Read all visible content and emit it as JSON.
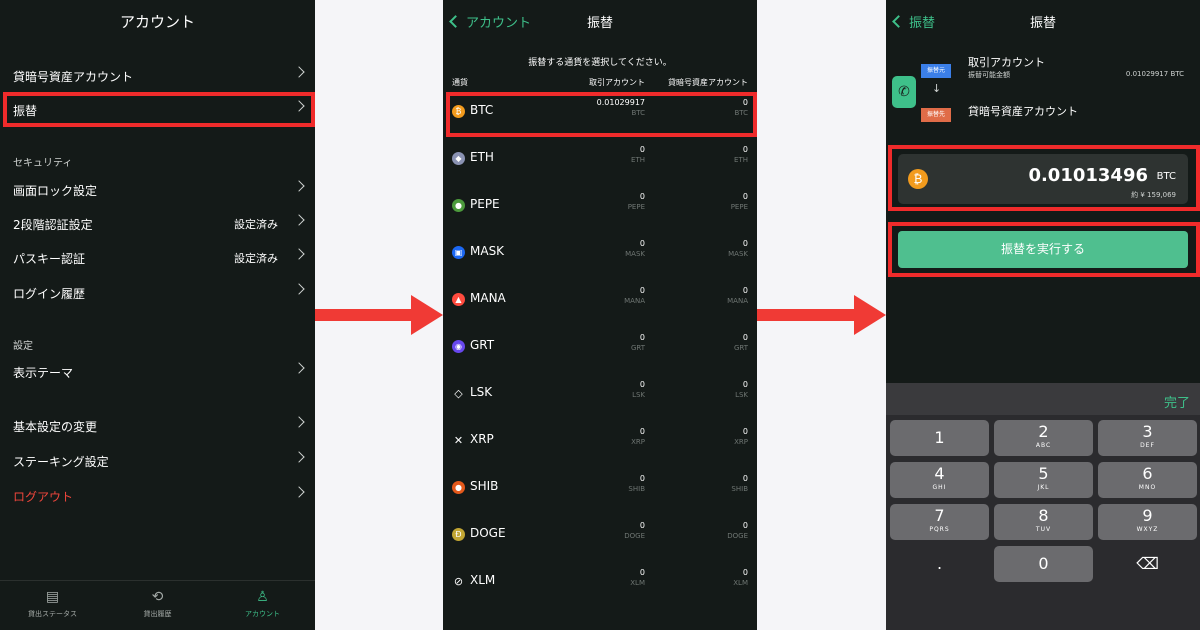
{
  "panel1": {
    "title": "アカウント",
    "items": {
      "crypto_account": "貸暗号資産アカウント",
      "transfer": "振替",
      "screen_lock": "画面ロック設定",
      "two_factor": "2段階認証設定",
      "two_factor_value": "設定済み",
      "passkey": "パスキー認証",
      "passkey_value": "設定済み",
      "login_history": "ログイン履歴",
      "theme": "表示テーマ",
      "basic_settings": "基本設定の変更",
      "staking": "ステーキング設定",
      "logout": "ログアウト"
    },
    "sections": {
      "security": "セキュリティ",
      "settings": "設定"
    },
    "tabs": [
      {
        "label": "貸出ステータス",
        "icon": "lending-status-icon"
      },
      {
        "label": "貸出履歴",
        "icon": "history-icon"
      },
      {
        "label": "アカウント",
        "icon": "account-icon"
      }
    ]
  },
  "panel2": {
    "back_label": "アカウント",
    "title": "振替",
    "instruction": "振替する通貨を選択してください。",
    "columns": {
      "currency": "通貨",
      "trading": "取引アカウント",
      "lending": "貸暗号資産アカウント"
    },
    "coins": [
      {
        "symbol": "BTC",
        "trading": "0.01029917",
        "lending": "0",
        "color": "#f29b1d",
        "glyph": "₿"
      },
      {
        "symbol": "ETH",
        "trading": "0",
        "lending": "0",
        "color": "#8a92b2",
        "glyph": "◆"
      },
      {
        "symbol": "PEPE",
        "trading": "0",
        "lending": "0",
        "color": "#4c9a3c",
        "glyph": "●"
      },
      {
        "symbol": "MASK",
        "trading": "0",
        "lending": "0",
        "color": "#1c68f3",
        "glyph": "▣"
      },
      {
        "symbol": "MANA",
        "trading": "0",
        "lending": "0",
        "color": "#ff4b3e",
        "glyph": "▲"
      },
      {
        "symbol": "GRT",
        "trading": "0",
        "lending": "0",
        "color": "#6747ed",
        "glyph": "◉"
      },
      {
        "symbol": "LSK",
        "trading": "0",
        "lending": "0",
        "color": "#141a18",
        "glyph": "◇"
      },
      {
        "symbol": "XRP",
        "trading": "0",
        "lending": "0",
        "color": "#141a18",
        "glyph": "✕"
      },
      {
        "symbol": "SHIB",
        "trading": "0",
        "lending": "0",
        "color": "#e4591b",
        "glyph": "●"
      },
      {
        "symbol": "DOGE",
        "trading": "0",
        "lending": "0",
        "color": "#c2a633",
        "glyph": "Ð"
      },
      {
        "symbol": "XLM",
        "trading": "0",
        "lending": "0",
        "color": "#141a18",
        "glyph": "⊘"
      }
    ]
  },
  "panel3": {
    "back_label": "振替",
    "title": "振替",
    "from_tag": "振替元",
    "to_tag": "振替先",
    "from_account": "取引アカウント",
    "available_label": "振替可能金額",
    "available_value": "0.01029917 BTC",
    "to_account": "貸暗号資産アカウント",
    "amount": "0.01013496",
    "amount_unit": "BTC",
    "amount_approx": "約 ¥ 159,069",
    "execute_button": "振替を実行する",
    "keyboard": {
      "done": "完了",
      "keys": [
        {
          "d": "1",
          "l": ""
        },
        {
          "d": "2",
          "l": "ABC"
        },
        {
          "d": "3",
          "l": "DEF"
        },
        {
          "d": "4",
          "l": "GHI"
        },
        {
          "d": "5",
          "l": "JKL"
        },
        {
          "d": "6",
          "l": "MNO"
        },
        {
          "d": "7",
          "l": "PQRS"
        },
        {
          "d": "8",
          "l": "TUV"
        },
        {
          "d": "9",
          "l": "WXYZ"
        },
        {
          "d": ".",
          "l": ""
        },
        {
          "d": "0",
          "l": ""
        },
        {
          "d": "⌫",
          "l": ""
        }
      ]
    }
  },
  "colors": {
    "accent": "#3ec08a",
    "highlight": "#f02b2b",
    "arrow": "#f03a35",
    "logout": "#f0463c"
  }
}
